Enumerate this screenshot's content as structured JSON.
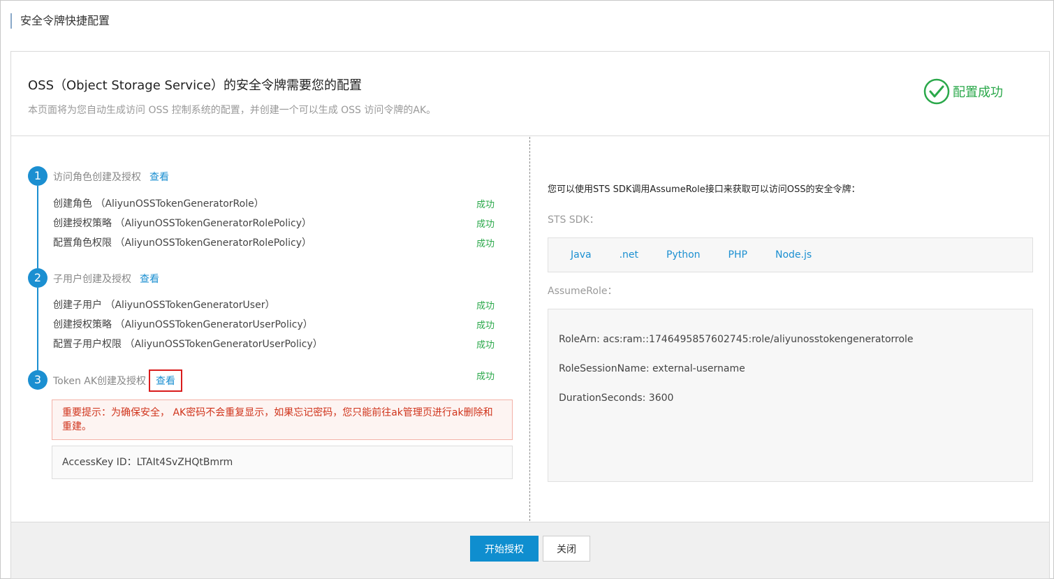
{
  "page": {
    "title": "安全令牌快捷配置"
  },
  "header": {
    "title": "OSS（Object Storage Service）的安全令牌需要您的配置",
    "description": "本页面将为您自动生成访问 OSS 控制系统的配置，并创建一个可以生成 OSS 访问令牌的AK。",
    "status": "配置成功",
    "status_color": "#2aa84a"
  },
  "steps": [
    {
      "num": "1",
      "label": "访问角色创建及授权",
      "link": "查看",
      "rows": [
        {
          "text": "创建角色 （AliyunOSSTokenGeneratorRole）",
          "status": "成功"
        },
        {
          "text": "创建授权策略 （AliyunOSSTokenGeneratorRolePolicy）",
          "status": "成功"
        },
        {
          "text": "配置角色权限 （AliyunOSSTokenGeneratorRolePolicy）",
          "status": "成功"
        }
      ]
    },
    {
      "num": "2",
      "label": "子用户创建及授权",
      "link": "查看",
      "rows": [
        {
          "text": "创建子用户 （AliyunOSSTokenGeneratorUser）",
          "status": "成功"
        },
        {
          "text": "创建授权策略 （AliyunOSSTokenGeneratorUserPolicy）",
          "status": "成功"
        },
        {
          "text": "配置子用户权限 （AliyunOSSTokenGeneratorUserPolicy）",
          "status": "成功"
        }
      ]
    },
    {
      "num": "3",
      "label": "Token AK创建及授权",
      "link": "查看",
      "status": "成功"
    }
  ],
  "warning": "重要提示：为确保安全， AK密码不会重复显示，如果忘记密码，您只能前往ak管理页进行ak删除和重建。",
  "access_key": "AccessKey ID：LTAIt4SvZHQtBmrm",
  "right": {
    "lead": "您可以使用STS SDK调用AssumeRole接口来获取可以访问OSS的安全令牌：",
    "sdk_label": "STS SDK：",
    "sdks": [
      "Java",
      ".net",
      "Python",
      "PHP",
      "Node.js"
    ],
    "assume_label": "AssumeRole：",
    "role_lines": [
      "RoleArn: acs:ram::1746495857602745:role/aliyunosstokengeneratorrole",
      "RoleSessionName: external-username",
      "DurationSeconds: 3600"
    ]
  },
  "footer": {
    "primary_label": "开始授权",
    "close_label": "关闭"
  },
  "colors": {
    "accent": "#1b8fd1",
    "success": "#2aa84a",
    "warning": "#d0341c",
    "primary_button": "#0f8ecf"
  }
}
